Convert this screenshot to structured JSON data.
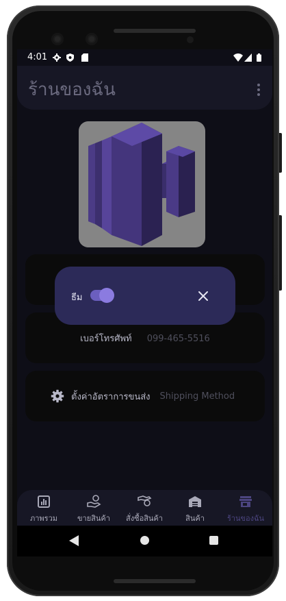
{
  "status": {
    "time": "4:01"
  },
  "appbar": {
    "title": "ร้านของฉัน"
  },
  "shop": {
    "phone_label": "เบอร์โทรศัพท์",
    "phone_value": "099-465-5516",
    "shipping_label": "ตั้งค่าอัตราการขนส่ง",
    "shipping_value": "Shipping Method"
  },
  "dialog": {
    "theme_label": "ธีม",
    "toggle_on": true
  },
  "nav": {
    "items": [
      {
        "label": "ภาพรวม"
      },
      {
        "label": "ขายสินค้า"
      },
      {
        "label": "สั่งซื้อสินค้า"
      },
      {
        "label": "สินค้า"
      },
      {
        "label": "ร้านของฉัน"
      }
    ],
    "active_index": 4
  },
  "colors": {
    "accent": "#6b5fbf",
    "dialog": "#2c2a58",
    "bar": "#171725"
  }
}
